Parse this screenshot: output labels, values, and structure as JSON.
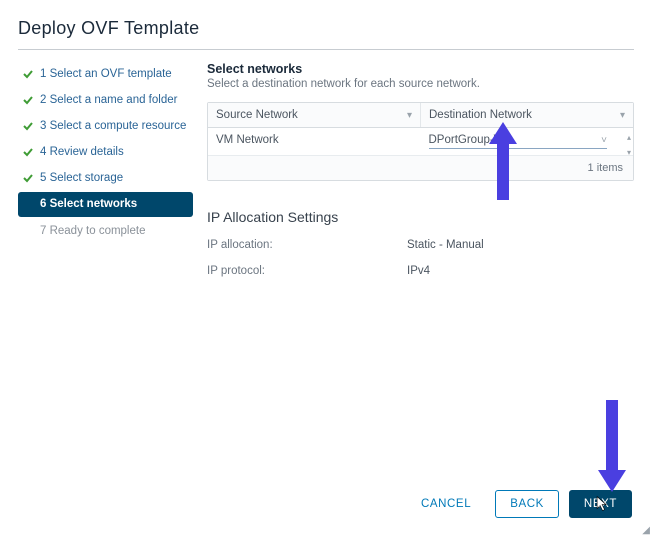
{
  "title": "Deploy OVF Template",
  "sidebar": {
    "steps": [
      {
        "label": "1 Select an OVF template",
        "state": "done"
      },
      {
        "label": "2 Select a name and folder",
        "state": "done"
      },
      {
        "label": "3 Select a compute resource",
        "state": "done"
      },
      {
        "label": "4 Review details",
        "state": "done"
      },
      {
        "label": "5 Select storage",
        "state": "done"
      },
      {
        "label": "6 Select networks",
        "state": "active"
      },
      {
        "label": "7 Ready to complete",
        "state": "pending"
      }
    ]
  },
  "main": {
    "heading": "Select networks",
    "sub": "Select a destination network for each source network.",
    "table": {
      "cols": {
        "source": "Source Network",
        "dest": "Destination Network"
      },
      "rows": [
        {
          "source": "VM Network",
          "dest": "DPortGroup-VM"
        }
      ],
      "footer_count": "1 items"
    },
    "ip": {
      "heading": "IP Allocation Settings",
      "rows": [
        {
          "k": "IP allocation:",
          "v": "Static - Manual"
        },
        {
          "k": "IP protocol:",
          "v": "IPv4"
        }
      ]
    }
  },
  "footer": {
    "cancel": "CANCEL",
    "back": "BACK",
    "next": "NEXT"
  },
  "colors": {
    "accent_arrow": "#4a3fe0",
    "accent_btn": "#00476b"
  }
}
